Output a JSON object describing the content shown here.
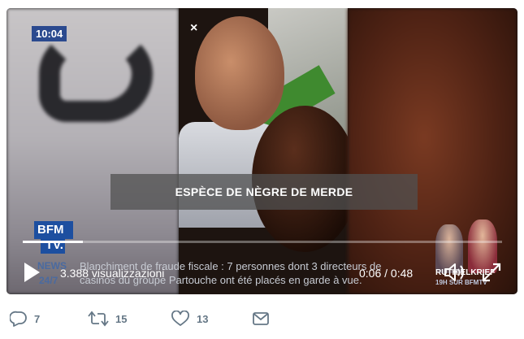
{
  "video": {
    "clock_badge": "10:04",
    "close_glyph": "×",
    "subtitle": "ESPÈCE DE NÈGRE DE MERDE",
    "channel_logo_line1": "BFM",
    "channel_logo_line2": "TV.",
    "ticker_label_top": "NEWS",
    "ticker_label_bottom": "24/7",
    "ticker_line1": "Blanchiment de fraude fiscale : 7 personnes dont 3 directeurs de",
    "ticker_line2": "casinos du groupe Partouche ont été placés en garde à vue.",
    "promo_title": "RUTH ELKRIEF",
    "promo_subtitle": "19H SUR BFMTV"
  },
  "player": {
    "views_label": "3.388 visualizzazioni",
    "time_readout": "0:06 / 0:48",
    "progress_fraction": 0.125,
    "icons": {
      "play": "play-icon",
      "volume": "volume-icon",
      "fullscreen": "fullscreen-icon"
    }
  },
  "actions": {
    "reply_count": "7",
    "retweet_count": "15",
    "like_count": "13",
    "icons": {
      "reply": "reply-icon",
      "retweet": "retweet-icon",
      "like": "heart-icon",
      "dm": "envelope-icon"
    },
    "icon_color": "#657786"
  },
  "colors": {
    "badge_blue": "#2b4a8f",
    "bfm_blue": "#1d4fa0"
  }
}
